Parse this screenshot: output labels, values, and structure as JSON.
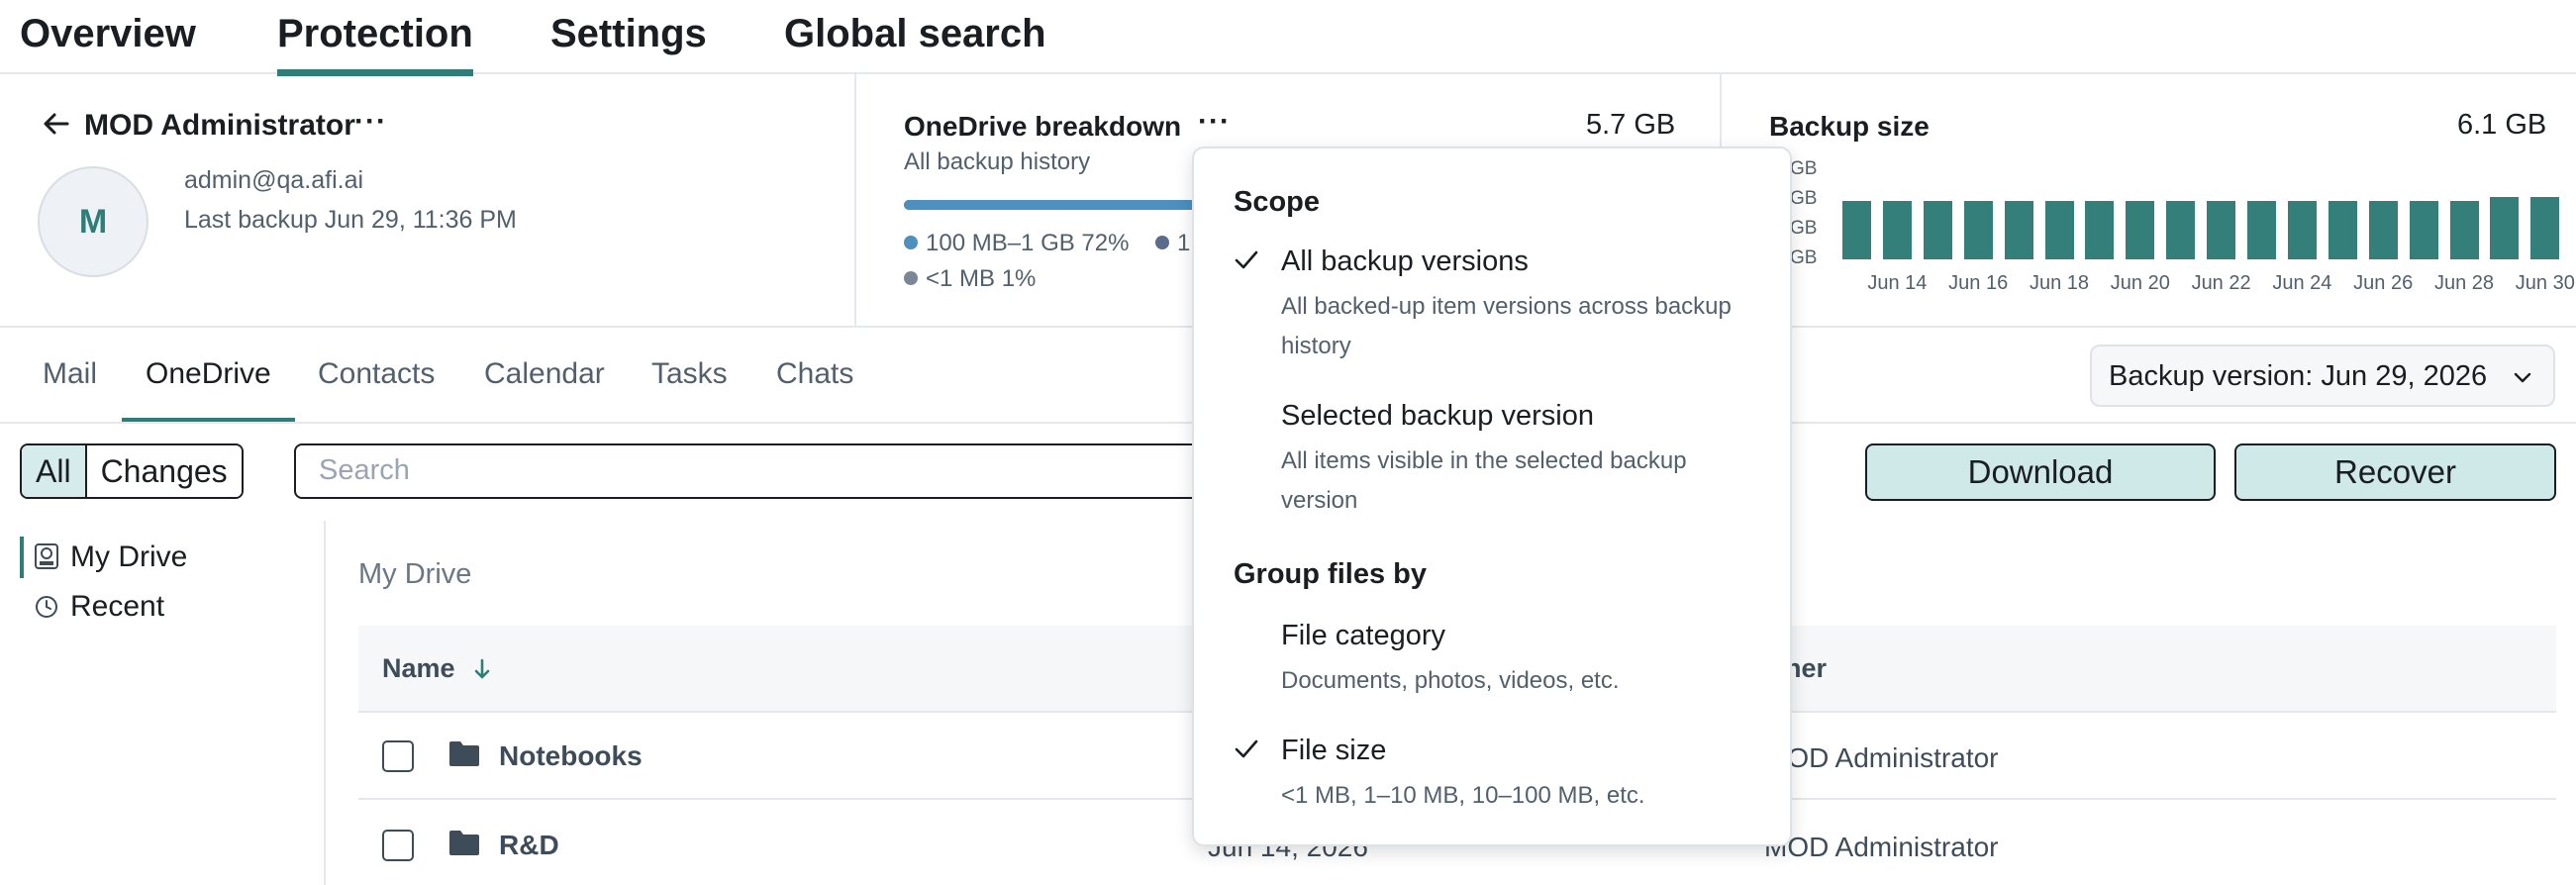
{
  "topnav": {
    "tabs": [
      {
        "label": "Overview"
      },
      {
        "label": "Protection"
      },
      {
        "label": "Settings"
      },
      {
        "label": "Global search"
      }
    ],
    "active_tab": "Protection"
  },
  "user": {
    "name": "MOD Administrator",
    "initial": "M",
    "email": "admin@qa.afi.ai",
    "last_backup": "Last backup Jun 29, 11:36 PM"
  },
  "onedrive_breakdown": {
    "title": "OneDrive breakdown",
    "total": "5.7 GB",
    "subtitle": "All backup history",
    "legend": [
      {
        "label": "100 MB–1 GB 72%",
        "color": "#4d8fbd",
        "fraction": 0.72
      },
      {
        "label": "1",
        "color": "#5a6b8c"
      },
      {
        "label": "<1 MB 1%",
        "color": "#7b8794",
        "fraction": 0.01
      }
    ]
  },
  "backup_size": {
    "title": "Backup size",
    "total": "6.1 GB",
    "y_tick_labels": [
      "GB",
      "GB",
      "GB",
      "GB"
    ]
  },
  "chart_data": {
    "type": "bar",
    "title": "Backup size",
    "xlabel": "",
    "ylabel": "",
    "x_tick_labels": [
      "Jun 14",
      "Jun 16",
      "Jun 18",
      "Jun 20",
      "Jun 22",
      "Jun 24",
      "Jun 26",
      "Jun 28",
      "Jun 30"
    ],
    "categories": [
      "Jun 13",
      "Jun 14",
      "Jun 15",
      "Jun 16",
      "Jun 17",
      "Jun 18",
      "Jun 19",
      "Jun 20",
      "Jun 21",
      "Jun 22",
      "Jun 23",
      "Jun 24",
      "Jun 25",
      "Jun 26",
      "Jun 27",
      "Jun 28",
      "Jun 29",
      "Jun 30"
    ],
    "values": [
      5.7,
      5.7,
      5.7,
      5.7,
      5.7,
      5.7,
      5.7,
      5.7,
      5.7,
      5.7,
      5.7,
      5.7,
      5.7,
      5.7,
      5.7,
      5.7,
      6.1,
      6.1
    ],
    "unit": "GB",
    "ylim": [
      0,
      6.1
    ],
    "grid": false,
    "color": "#357f7b"
  },
  "subtabs": {
    "items": [
      {
        "label": "Mail"
      },
      {
        "label": "OneDrive"
      },
      {
        "label": "Contacts"
      },
      {
        "label": "Calendar"
      },
      {
        "label": "Tasks"
      },
      {
        "label": "Chats"
      }
    ],
    "active": "OneDrive",
    "version_select": "Backup version: Jun 29, 2026"
  },
  "toolbar": {
    "filter_all": "All",
    "filter_changes": "Changes",
    "search_placeholder": "Search",
    "download_label": "Download",
    "recover_label": "Recover"
  },
  "tree": {
    "items": [
      {
        "label": "My Drive",
        "icon": "drive-icon",
        "selected": true
      },
      {
        "label": "Recent",
        "icon": "clock-icon",
        "selected": false
      }
    ]
  },
  "table": {
    "breadcrumb": "My Drive",
    "headers": {
      "name": "Name",
      "owner": "wner"
    },
    "rows": [
      {
        "name": "Notebooks",
        "date": "",
        "owner": "MOD Administrator",
        "icon": "folder-icon"
      },
      {
        "name": "R&D",
        "date": "Jun 14, 2026",
        "owner": "MOD Administrator",
        "icon": "folder-icon"
      }
    ]
  },
  "dropdown": {
    "scope_heading": "Scope",
    "scope_options": [
      {
        "label": "All backup versions",
        "description": "All backed-up item versions across backup history",
        "checked": true
      },
      {
        "label": "Selected backup version",
        "description": "All items visible in the selected backup version",
        "checked": false
      }
    ],
    "group_heading": "Group files by",
    "group_options": [
      {
        "label": "File category",
        "description": "Documents, photos, videos, etc.",
        "checked": false
      },
      {
        "label": "File size",
        "description": "<1 MB, 1–10 MB, 10–100 MB, etc.",
        "checked": true
      }
    ]
  }
}
